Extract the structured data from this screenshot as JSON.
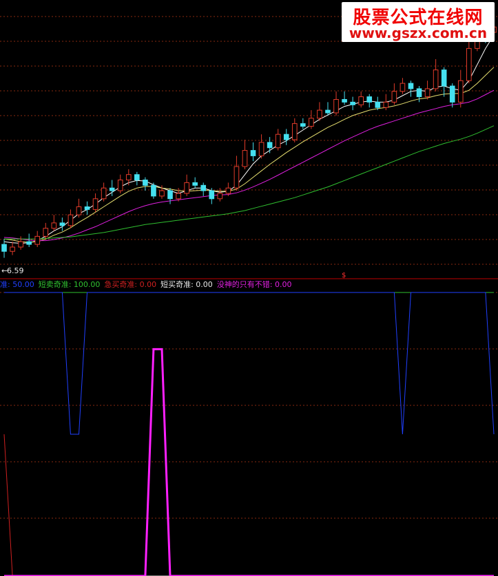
{
  "watermark": {
    "line1": "股票公式在线网",
    "line2": "www.gszx.com.cn"
  },
  "price_label": "6.59",
  "marker_symbol": "$",
  "colors": {
    "background": "#000000",
    "grid": "#8a2a10",
    "separator": "#c00000",
    "up": "#e23b2a",
    "down": "#45e0f0",
    "ma_short": "#ffffff",
    "ma_mid": "#e8e070",
    "ma_long": "#e020e0",
    "ma_xlong": "#30c030",
    "blue_line": "#2040ff",
    "green_line": "#30c030",
    "red_line": "#d02020",
    "magenta_line": "#ff20ff"
  },
  "legend": [
    {
      "label": "准",
      "value": "50.00",
      "color": "#2040ff"
    },
    {
      "label": "短卖奇准",
      "value": "100.00",
      "color": "#30c030"
    },
    {
      "label": "急买奇准",
      "value": "0.00",
      "color": "#d02020"
    },
    {
      "label": "短买奇准",
      "value": "0.00",
      "color": "#e8e8e8"
    },
    {
      "label": "没神的只有不错",
      "value": "0.00",
      "color": "#e020e0"
    }
  ],
  "chart_data": [
    {
      "type": "candlestick",
      "title": "",
      "ylim": [
        6.3,
        11.3
      ],
      "grid": true,
      "annotations": [
        "6.59"
      ],
      "candles": [
        [
          6.85,
          6.72,
          6.95,
          6.6
        ],
        [
          6.72,
          6.8,
          6.9,
          6.65
        ],
        [
          6.8,
          6.9,
          7.0,
          6.75
        ],
        [
          6.9,
          6.85,
          7.05,
          6.8
        ],
        [
          6.85,
          7.0,
          7.1,
          6.8
        ],
        [
          7.0,
          7.15,
          7.25,
          6.95
        ],
        [
          7.15,
          7.25,
          7.4,
          7.1
        ],
        [
          7.25,
          7.2,
          7.35,
          7.1
        ],
        [
          7.2,
          7.4,
          7.5,
          7.15
        ],
        [
          7.4,
          7.55,
          7.7,
          7.35
        ],
        [
          7.55,
          7.5,
          7.65,
          7.4
        ],
        [
          7.5,
          7.7,
          7.8,
          7.45
        ],
        [
          7.7,
          7.9,
          8.0,
          7.65
        ],
        [
          7.9,
          7.85,
          8.05,
          7.75
        ],
        [
          7.85,
          8.05,
          8.15,
          7.8
        ],
        [
          8.05,
          8.15,
          8.25,
          7.95
        ],
        [
          8.15,
          8.05,
          8.2,
          7.95
        ],
        [
          8.05,
          7.95,
          8.1,
          7.85
        ],
        [
          7.95,
          7.75,
          8.0,
          7.7
        ],
        [
          7.75,
          7.85,
          7.95,
          7.7
        ],
        [
          7.85,
          7.7,
          7.9,
          7.6
        ],
        [
          7.7,
          7.8,
          7.9,
          7.65
        ],
        [
          7.8,
          8.0,
          8.15,
          7.75
        ],
        [
          8.0,
          7.95,
          8.1,
          7.9
        ],
        [
          7.95,
          7.85,
          8.0,
          7.75
        ],
        [
          7.85,
          7.7,
          7.9,
          7.6
        ],
        [
          7.7,
          7.8,
          7.9,
          7.65
        ],
        [
          7.8,
          7.9,
          8.0,
          7.75
        ],
        [
          7.9,
          8.3,
          8.5,
          7.85
        ],
        [
          8.3,
          8.6,
          8.8,
          8.25
        ],
        [
          8.6,
          8.5,
          8.75,
          8.4
        ],
        [
          8.5,
          8.75,
          8.9,
          8.45
        ],
        [
          8.75,
          8.65,
          8.85,
          8.55
        ],
        [
          8.65,
          8.9,
          9.0,
          8.6
        ],
        [
          8.9,
          8.8,
          9.0,
          8.7
        ],
        [
          8.8,
          9.1,
          9.2,
          8.75
        ],
        [
          9.1,
          9.05,
          9.2,
          9.0
        ],
        [
          9.05,
          9.2,
          9.35,
          9.0
        ],
        [
          9.2,
          9.35,
          9.5,
          9.15
        ],
        [
          9.35,
          9.3,
          9.5,
          9.25
        ],
        [
          9.3,
          9.55,
          9.7,
          9.25
        ],
        [
          9.55,
          9.5,
          9.7,
          9.45
        ],
        [
          9.5,
          9.45,
          9.6,
          9.35
        ],
        [
          9.45,
          9.6,
          9.7,
          9.4
        ],
        [
          9.6,
          9.5,
          9.65,
          9.4
        ],
        [
          9.5,
          9.4,
          9.6,
          9.35
        ],
        [
          9.4,
          9.5,
          9.65,
          9.35
        ],
        [
          9.5,
          9.7,
          9.85,
          9.45
        ],
        [
          9.7,
          9.85,
          9.95,
          9.65
        ],
        [
          9.85,
          9.75,
          9.9,
          9.6
        ],
        [
          9.75,
          9.6,
          9.8,
          9.5
        ],
        [
          9.6,
          9.75,
          9.9,
          9.55
        ],
        [
          9.75,
          10.1,
          10.3,
          9.7
        ],
        [
          10.1,
          9.8,
          10.15,
          9.6
        ],
        [
          9.8,
          9.5,
          9.85,
          9.4
        ],
        [
          9.5,
          9.9,
          10.1,
          9.4
        ],
        [
          9.9,
          10.5,
          11.0,
          9.85
        ],
        [
          10.5,
          11.0,
          11.2,
          10.45
        ],
        [
          11.0,
          10.8,
          11.1,
          10.6
        ],
        [
          10.8,
          10.9,
          11.05,
          10.7
        ]
      ],
      "series": [
        {
          "name": "",
          "values": [
            6.9,
            6.88,
            6.87,
            6.88,
            6.92,
            7.0,
            7.1,
            7.18,
            7.3,
            7.42,
            7.5,
            7.6,
            7.72,
            7.82,
            7.92,
            8.0,
            8.04,
            8.03,
            7.96,
            7.9,
            7.85,
            7.8,
            7.85,
            7.9,
            7.9,
            7.85,
            7.82,
            7.84,
            7.95,
            8.15,
            8.35,
            8.5,
            8.6,
            8.7,
            8.78,
            8.88,
            8.98,
            9.08,
            9.18,
            9.26,
            9.34,
            9.42,
            9.46,
            9.5,
            9.52,
            9.5,
            9.5,
            9.54,
            9.62,
            9.7,
            9.72,
            9.7,
            9.78,
            9.8,
            9.75,
            9.72,
            9.9,
            10.2,
            10.5,
            10.75
          ]
        },
        {
          "name": "",
          "values": [
            6.95,
            6.93,
            6.9,
            6.89,
            6.9,
            6.95,
            7.02,
            7.08,
            7.16,
            7.26,
            7.35,
            7.45,
            7.55,
            7.65,
            7.75,
            7.84,
            7.9,
            7.93,
            7.93,
            7.9,
            7.88,
            7.85,
            7.84,
            7.85,
            7.86,
            7.85,
            7.84,
            7.84,
            7.88,
            7.98,
            8.1,
            8.22,
            8.34,
            8.45,
            8.56,
            8.66,
            8.76,
            8.85,
            8.94,
            9.03,
            9.1,
            9.18,
            9.25,
            9.3,
            9.35,
            9.38,
            9.4,
            9.43,
            9.47,
            9.52,
            9.56,
            9.58,
            9.62,
            9.65,
            9.66,
            9.66,
            9.72,
            9.85,
            10.0,
            10.15
          ]
        },
        {
          "name": "",
          "values": [
            6.98,
            6.97,
            6.95,
            6.93,
            6.92,
            6.92,
            6.94,
            6.97,
            7.01,
            7.06,
            7.12,
            7.18,
            7.25,
            7.32,
            7.39,
            7.46,
            7.52,
            7.57,
            7.61,
            7.64,
            7.66,
            7.68,
            7.7,
            7.72,
            7.74,
            7.76,
            7.77,
            7.78,
            7.81,
            7.86,
            7.92,
            7.99,
            8.06,
            8.14,
            8.22,
            8.3,
            8.38,
            8.46,
            8.54,
            8.62,
            8.7,
            8.78,
            8.85,
            8.92,
            8.99,
            9.05,
            9.1,
            9.15,
            9.2,
            9.25,
            9.3,
            9.34,
            9.38,
            9.42,
            9.45,
            9.47,
            9.5,
            9.56,
            9.64,
            9.72
          ]
        },
        {
          "name": "",
          "values": [
            6.95,
            6.95,
            6.95,
            6.95,
            6.95,
            6.96,
            6.97,
            6.98,
            6.99,
            7.01,
            7.03,
            7.05,
            7.07,
            7.1,
            7.13,
            7.16,
            7.19,
            7.22,
            7.24,
            7.26,
            7.28,
            7.3,
            7.32,
            7.34,
            7.36,
            7.38,
            7.4,
            7.42,
            7.45,
            7.48,
            7.52,
            7.56,
            7.6,
            7.64,
            7.68,
            7.72,
            7.77,
            7.82,
            7.87,
            7.92,
            7.98,
            8.04,
            8.1,
            8.16,
            8.22,
            8.28,
            8.34,
            8.4,
            8.46,
            8.52,
            8.58,
            8.63,
            8.68,
            8.73,
            8.77,
            8.81,
            8.86,
            8.92,
            8.99,
            9.06
          ]
        }
      ]
    },
    {
      "type": "line",
      "title": "",
      "ylim": [
        0,
        100
      ],
      "grid": true,
      "series": [
        {
          "name": "准",
          "values": [
            100,
            100,
            100,
            100,
            100,
            100,
            100,
            100,
            50,
            50,
            100,
            100,
            100,
            100,
            100,
            100,
            100,
            100,
            100,
            100,
            100,
            100,
            100,
            100,
            100,
            100,
            100,
            100,
            100,
            100,
            100,
            100,
            100,
            100,
            100,
            100,
            100,
            100,
            100,
            100,
            100,
            100,
            100,
            100,
            100,
            100,
            100,
            100,
            50,
            100,
            100,
            100,
            100,
            100,
            100,
            100,
            100,
            100,
            100,
            50
          ]
        },
        {
          "name": "短卖奇准",
          "values": [
            100,
            100,
            100,
            100,
            100,
            100,
            100,
            100,
            100,
            100,
            100,
            100,
            100,
            100,
            100,
            100,
            100,
            100,
            100,
            100,
            100,
            100,
            100,
            100,
            100,
            100,
            100,
            100,
            100,
            100,
            100,
            100,
            100,
            100,
            100,
            100,
            100,
            100,
            100,
            100,
            100,
            100,
            100,
            100,
            100,
            100,
            100,
            100,
            100,
            100,
            100,
            100,
            100,
            100,
            100,
            100,
            100,
            100,
            100,
            100
          ]
        },
        {
          "name": "急买奇准",
          "values": [
            50,
            0,
            0,
            0,
            0,
            0,
            0,
            0,
            0,
            0,
            0,
            0,
            0,
            0,
            0,
            0,
            0,
            0,
            0,
            0,
            0,
            0,
            0,
            0,
            0,
            0,
            0,
            0,
            0,
            0,
            0,
            0,
            0,
            0,
            0,
            0,
            0,
            0,
            0,
            0,
            0,
            0,
            0,
            0,
            0,
            0,
            0,
            0,
            0,
            0,
            0,
            0,
            0,
            0,
            0,
            0,
            0,
            0,
            0,
            0
          ]
        },
        {
          "name": "短买奇准",
          "values": [
            0,
            0,
            0,
            0,
            0,
            0,
            0,
            0,
            0,
            0,
            0,
            0,
            0,
            0,
            0,
            0,
            0,
            0,
            0,
            0,
            0,
            0,
            0,
            0,
            0,
            0,
            0,
            0,
            0,
            0,
            0,
            0,
            0,
            0,
            0,
            0,
            0,
            0,
            0,
            0,
            0,
            0,
            0,
            0,
            0,
            0,
            0,
            0,
            0,
            0,
            0,
            0,
            0,
            0,
            0,
            0,
            0,
            0,
            0,
            0
          ]
        },
        {
          "name": "没神的只有不错",
          "values": [
            0,
            0,
            0,
            0,
            0,
            0,
            0,
            0,
            0,
            0,
            0,
            0,
            0,
            0,
            0,
            0,
            0,
            0,
            80,
            80,
            0,
            0,
            0,
            0,
            0,
            0,
            0,
            0,
            0,
            0,
            0,
            0,
            0,
            0,
            0,
            0,
            0,
            0,
            0,
            0,
            0,
            0,
            0,
            0,
            0,
            0,
            0,
            0,
            0,
            0,
            0,
            0,
            0,
            0,
            0,
            0,
            0,
            0,
            0,
            0
          ]
        }
      ]
    }
  ]
}
